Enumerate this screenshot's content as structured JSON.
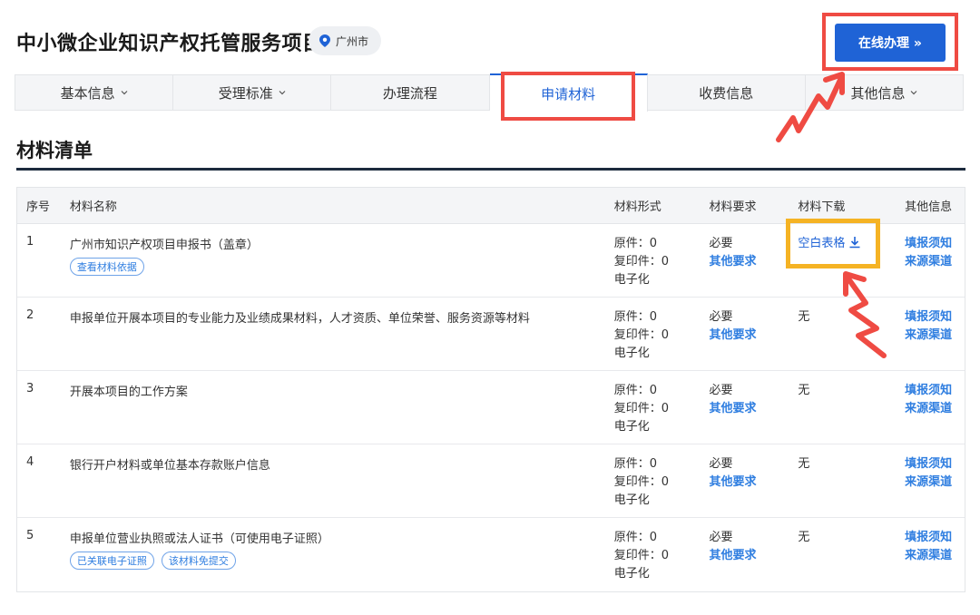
{
  "header": {
    "title": "中小微企业知识产权托管服务项目",
    "location": "广州市",
    "online_button": "在线办理 »"
  },
  "tabs": [
    {
      "label": "基本信息",
      "dropdown": true
    },
    {
      "label": "受理标准",
      "dropdown": true
    },
    {
      "label": "办理流程",
      "dropdown": false
    },
    {
      "label": "申请材料",
      "dropdown": false,
      "active": true
    },
    {
      "label": "收费信息",
      "dropdown": false
    },
    {
      "label": "其他信息",
      "dropdown": true
    }
  ],
  "section": {
    "title": "材料清单"
  },
  "table": {
    "headers": [
      "序号",
      "材料名称",
      "材料形式",
      "材料要求",
      "材料下载",
      "其他信息"
    ],
    "rows": [
      {
        "no": "1",
        "name": "广州市知识产权项目申报书（盖章）",
        "tags": [
          "查看材料依据"
        ],
        "form": [
          "原件：0",
          "复印件：0",
          "电子化"
        ],
        "req": "必要",
        "req_link": "其他要求",
        "download": "空白表格",
        "other": [
          "填报须知",
          "来源渠道"
        ]
      },
      {
        "no": "2",
        "name": "申报单位开展本项目的专业能力及业绩成果材料，人才资质、单位荣誉、服务资源等材料",
        "tags": [],
        "form": [
          "原件：0",
          "复印件：0",
          "电子化"
        ],
        "req": "必要",
        "req_link": "其他要求",
        "download": "无",
        "other": [
          "填报须知",
          "来源渠道"
        ]
      },
      {
        "no": "3",
        "name": "开展本项目的工作方案",
        "tags": [],
        "form": [
          "原件：0",
          "复印件：0",
          "电子化"
        ],
        "req": "必要",
        "req_link": "其他要求",
        "download": "无",
        "other": [
          "填报须知",
          "来源渠道"
        ]
      },
      {
        "no": "4",
        "name": "银行开户材料或单位基本存款账户信息",
        "tags": [],
        "form": [
          "原件：0",
          "复印件：0",
          "电子化"
        ],
        "req": "必要",
        "req_link": "其他要求",
        "download": "无",
        "other": [
          "填报须知",
          "来源渠道"
        ]
      },
      {
        "no": "5",
        "name": "申报单位营业执照或法人证书（可使用电子证照）",
        "tags": [
          "已关联电子证照",
          "该材料免提交"
        ],
        "form": [
          "原件：0",
          "复印件：0",
          "电子化"
        ],
        "req": "必要",
        "req_link": "其他要求",
        "download": "无",
        "other": [
          "填报须知",
          "来源渠道"
        ]
      }
    ]
  },
  "colors": {
    "accent": "#1f63d6",
    "highlight_red": "#ef4b43",
    "highlight_yellow": "#f5b324"
  }
}
